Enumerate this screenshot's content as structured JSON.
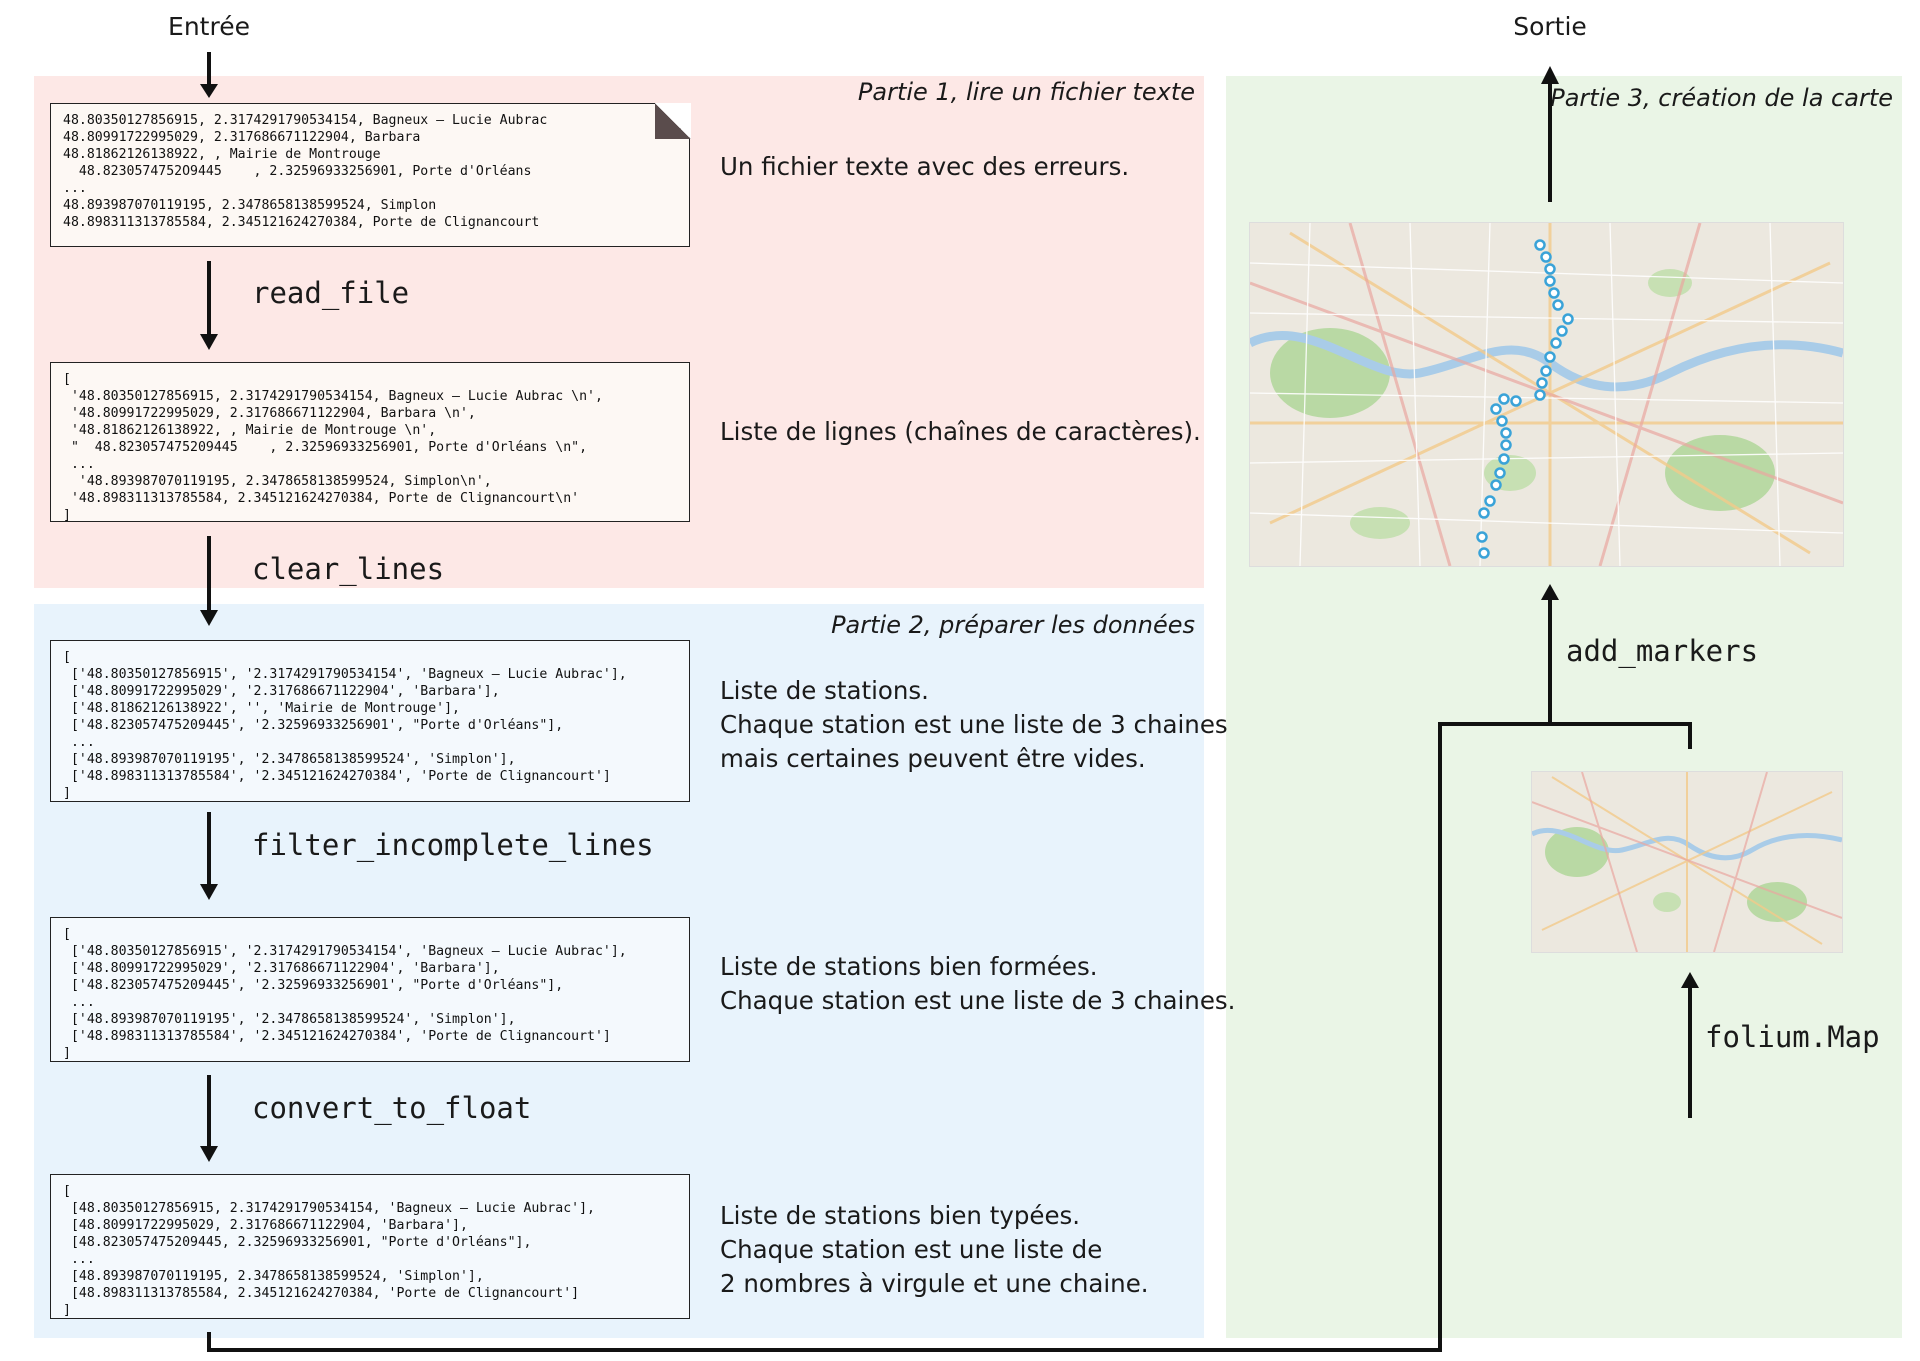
{
  "io": {
    "input": "Entrée",
    "output": "Sortie"
  },
  "parts": {
    "part1": "Partie 1, lire un fichier texte",
    "part2": "Partie 2, préparer les données",
    "part3": "Partie 3, création de la carte"
  },
  "boxes": [
    {
      "code": "48.80350127856915, 2.3174291790534154, Bagneux – Lucie Aubrac\n48.80991722995029, 2.317686671122904, Barbara\n48.81862126138922, , Mairie de Montrouge\n  48.8230574752O9445    , 2.32596933256901, Porte d'Orléans\n...\n48.893987070119195, 2.3478658138599524, Simplon\n48.898311313785584, 2.345121624270384, Porte de Clignancourt",
      "description": [
        "Un fichier texte avec des erreurs."
      ]
    },
    {
      "code": "[\n '48.80350127856915, 2.3174291790534154, Bagneux – Lucie Aubrac \\n',\n '48.80991722995029, 2.317686671122904, Barbara \\n',\n '48.81862126138922, , Mairie de Montrouge \\n',\n \"  48.823057475209445    , 2.32596933256901, Porte d'Orléans \\n\",\n ...\n  '48.893987070119195, 2.3478658138599524, Simplon\\n',\n '48.898311313785584, 2.345121624270384, Porte de Clignancourt\\n'\n]",
      "description": [
        "Liste de lignes (chaînes de caractères)."
      ]
    },
    {
      "code": "[\n ['48.80350127856915', '2.3174291790534154', 'Bagneux – Lucie Aubrac'],\n ['48.80991722995029', '2.317686671122904', 'Barbara'],\n ['48.81862126138922', '', 'Mairie de Montrouge'],\n ['48.823057475209445', '2.32596933256901', \"Porte d'Orléans\"],\n ...\n ['48.893987070119195', '2.3478658138599524', 'Simplon'],\n ['48.898311313785584', '2.345121624270384', 'Porte de Clignancourt']\n]",
      "description": [
        "Liste de stations.",
        "Chaque station est une liste de 3 chaines",
        "mais certaines peuvent être vides."
      ]
    },
    {
      "code": "[\n ['48.80350127856915', '2.3174291790534154', 'Bagneux – Lucie Aubrac'],\n ['48.80991722995029', '2.317686671122904', 'Barbara'],\n ['48.823057475209445', '2.32596933256901', \"Porte d'Orléans\"],\n ...\n ['48.893987070119195', '2.3478658138599524', 'Simplon'],\n ['48.898311313785584', '2.345121624270384', 'Porte de Clignancourt']\n]",
      "description": [
        "Liste de stations bien formées.",
        "Chaque station est une liste de 3 chaines."
      ]
    },
    {
      "code": "[\n [48.80350127856915, 2.3174291790534154, 'Bagneux – Lucie Aubrac'],\n [48.80991722995029, 2.317686671122904, 'Barbara'],\n [48.823057475209445, 2.32596933256901, \"Porte d'Orléans\"],\n ...\n [48.893987070119195, 2.3478658138599524, 'Simplon'],\n [48.898311313785584, 2.345121624270384, 'Porte de Clignancourt']\n]",
      "description": [
        "Liste de stations bien typées.",
        "Chaque station est une liste de",
        "2 nombres à virgule et une chaine."
      ]
    }
  ],
  "functions": {
    "read_file": "read_file",
    "clear_lines": "clear_lines",
    "filter_incomplete_lines": "filter_incomplete_lines",
    "convert_to_float": "convert_to_float",
    "add_markers": "add_markers",
    "folium_map": "folium.Map"
  },
  "colors": {
    "part1_bg": "#fde8e6",
    "part2_bg": "#e8f3fc",
    "part3_bg": "#eaf5e6",
    "marker": "#3aa3d8",
    "arrow": "#111111"
  },
  "icons": {
    "file_corner": "dog-ear-icon",
    "marker": "map-marker-icon"
  }
}
